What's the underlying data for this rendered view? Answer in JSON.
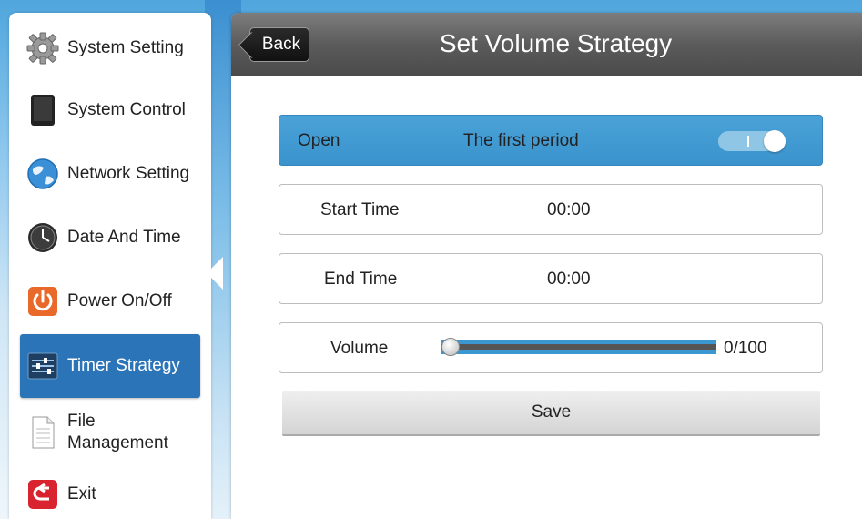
{
  "sidebar": {
    "items": [
      {
        "label": "System Setting",
        "icon": "gear-icon"
      },
      {
        "label": "System Control",
        "icon": "tablet-icon"
      },
      {
        "label": "Network Setting",
        "icon": "globe-icon"
      },
      {
        "label": "Date And Time",
        "icon": "clock-icon"
      },
      {
        "label": "Power On/Off",
        "icon": "power-icon"
      },
      {
        "label": "Timer Strategy",
        "icon": "sliders-icon"
      },
      {
        "label": "File\nManagement",
        "icon": "file-icon"
      },
      {
        "label": "Exit",
        "icon": "exit-icon"
      }
    ],
    "active_index": 5
  },
  "header": {
    "title": "Set Volume Strategy",
    "back_label": "Back"
  },
  "form": {
    "open_label": "Open",
    "period_label": "The first period",
    "toggle_state": "on",
    "start_time_label": "Start Time",
    "start_time_value": "00:00",
    "end_time_label": "End Time",
    "end_time_value": "00:00",
    "volume_label": "Volume",
    "volume_value": 0,
    "volume_max": 100,
    "volume_readout": "0/100",
    "save_label": "Save"
  },
  "colors": {
    "accent": "#2c74b8",
    "row_highlight": "#3f98d1",
    "header_bg": "#5b5b5b"
  }
}
